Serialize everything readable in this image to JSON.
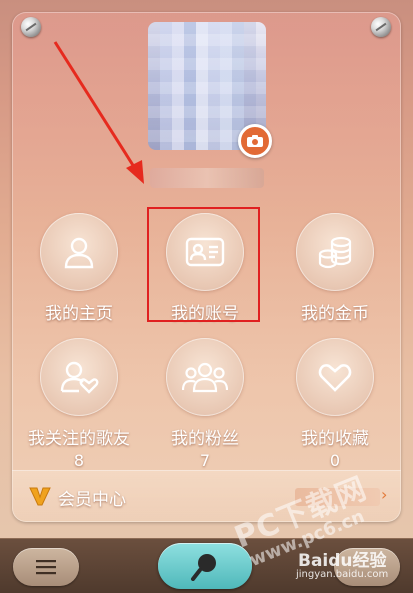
{
  "grid": [
    {
      "label": "我的主页",
      "count": "",
      "icon": "person-icon"
    },
    {
      "label": "我的账号",
      "count": "",
      "icon": "id-card-icon"
    },
    {
      "label": "我的金币",
      "count": "",
      "icon": "coins-icon"
    },
    {
      "label": "我关注的歌友",
      "count": "8",
      "icon": "person-heart-icon"
    },
    {
      "label": "我的粉丝",
      "count": "7",
      "icon": "group-icon"
    },
    {
      "label": "我的收藏",
      "count": "0",
      "icon": "heart-icon"
    }
  ],
  "vip": {
    "label": "会员中心",
    "icon": "vip-v-icon",
    "chevron": "›"
  },
  "bottom": {
    "menu_icon": "menu-icon",
    "search_icon": "microphone-search-icon"
  },
  "watermark": {
    "site": "PC下载网",
    "url": "www.pc6.cn",
    "baidu": "Baidu经验",
    "baidu_url": "jingyan.baidu.com"
  },
  "colors": {
    "highlight": "#e02020",
    "camera": "#e26a35",
    "search": "#4fb8ba"
  }
}
